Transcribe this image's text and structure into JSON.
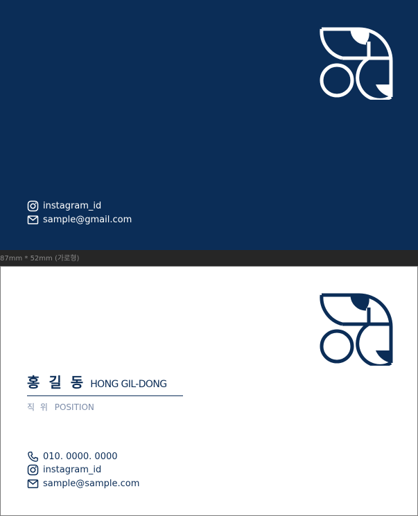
{
  "colors": {
    "navy": "#0b2d57",
    "white": "#ffffff",
    "position_gray": "#7b8ba8",
    "workspace": "#262626"
  },
  "front": {
    "instagram": "instagram_id",
    "email": "sample@gmail.com",
    "icons": [
      "logo-mark-icon",
      "instagram-icon",
      "mail-icon"
    ]
  },
  "separator": {
    "label": "87mm * 52mm (가로형)"
  },
  "back": {
    "name_ko": "홍 길 동",
    "name_en": "HONG GIL-DONG",
    "position_ko": "직 위",
    "position_en": "POSITION",
    "phone": "010. 0000. 0000",
    "instagram": "instagram_id",
    "email": "sample@sample.com",
    "icons": [
      "logo-mark-icon",
      "phone-icon",
      "instagram-icon",
      "mail-icon"
    ]
  }
}
